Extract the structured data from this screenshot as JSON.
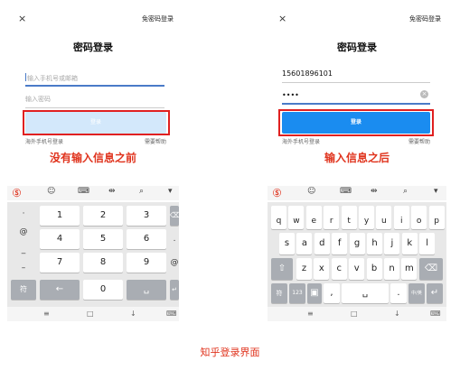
{
  "left_screen": {
    "close_icon": "×",
    "sms_login_link": "免密码登录",
    "title": "密码登录",
    "phone_placeholder": "输入手机号或邮箱",
    "password_placeholder": "输入密码",
    "login_button": "登录",
    "overseas_link": "海外手机号登录",
    "help_link": "需要帮助",
    "caption": "没有输入信息之前",
    "numpad": {
      "left_symbols": [
        "·",
        "@",
        "_",
        "–"
      ],
      "digits": [
        "1",
        "2",
        "3",
        "4",
        "5",
        "6",
        "7",
        "8",
        "9",
        "0"
      ],
      "right_symbols": [
        ".",
        "@"
      ],
      "bottom_left": "符"
    }
  },
  "right_screen": {
    "close_icon": "×",
    "sms_login_link": "免密码登录",
    "title": "密码登录",
    "phone_value": "15601896101",
    "password_value": "••••",
    "clear_icon": "×",
    "login_button": "登录",
    "overseas_link": "海外手机号登录",
    "help_link": "需要帮助",
    "caption": "输入信息之后",
    "qwerty": {
      "row_numbers": [
        "1",
        "2",
        "3",
        "4",
        "5",
        "6",
        "7",
        "8",
        "9",
        "0"
      ],
      "row1": [
        "q",
        "w",
        "e",
        "r",
        "t",
        "y",
        "u",
        "i",
        "o",
        "p"
      ],
      "row2": [
        "s",
        "a",
        "d",
        "f",
        "g",
        "h",
        "j",
        "k",
        "l"
      ],
      "row3": [
        "z",
        "x",
        "c",
        "v",
        "b",
        "n",
        "m"
      ],
      "row4_left": [
        "符",
        "123"
      ],
      "comma": ",",
      "period": ".",
      "lang": "中/英"
    }
  },
  "toolbar_icons": [
    "keyboard-logo-icon",
    "emoji-icon",
    "keyboard-icon",
    "cursor-icon",
    "search-icon",
    "collapse-icon"
  ],
  "footer_caption": "知乎登录界面",
  "colors": {
    "accent": "#1a8cf0",
    "disabled_button": "#d3e8fb",
    "highlight": "#e02020",
    "caption": "#e0341e"
  }
}
